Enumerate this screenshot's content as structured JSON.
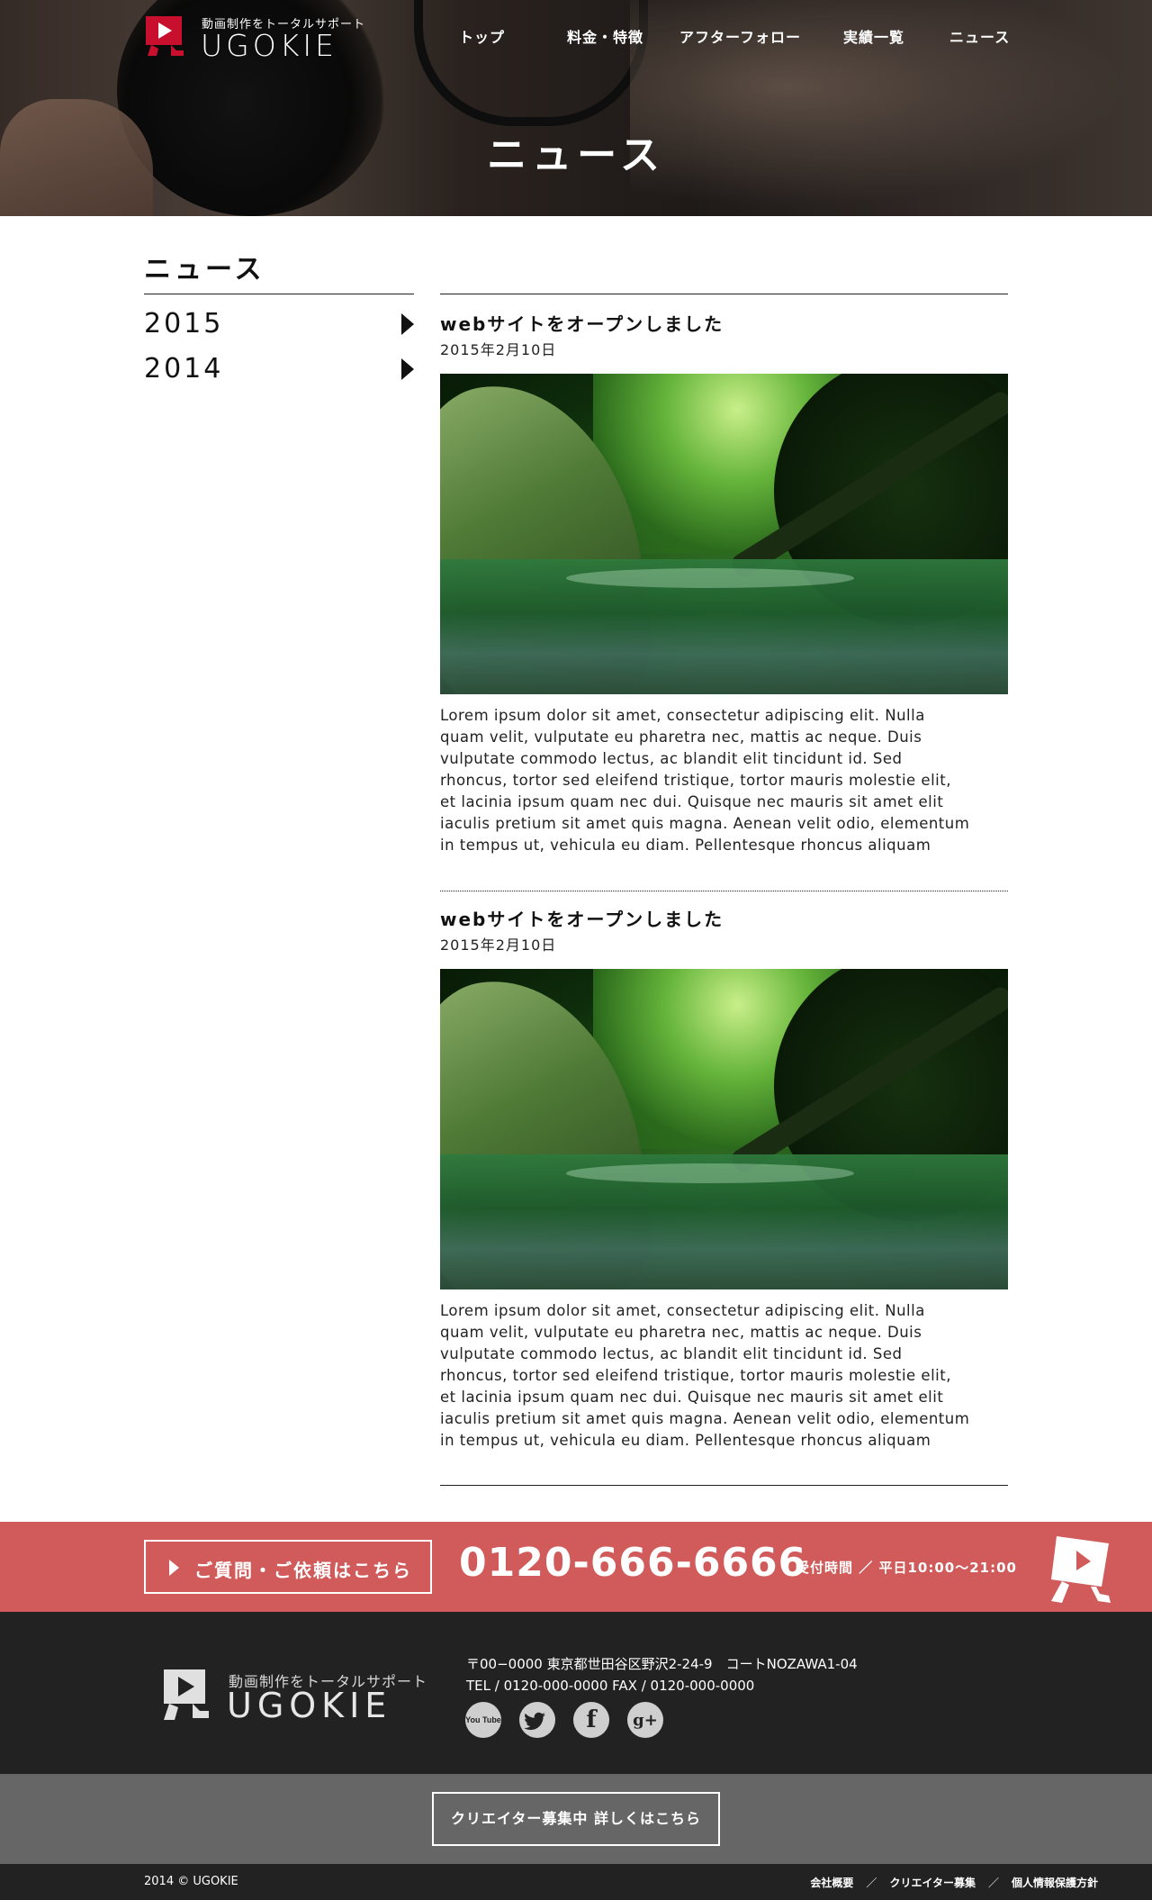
{
  "header": {
    "logo_tagline": "動画制作をトータルサポート",
    "logo_wordmark": "UGOKIE",
    "nav": [
      {
        "label": "トップ"
      },
      {
        "label": "料金・特徴"
      },
      {
        "label": "アフターフォロー"
      },
      {
        "label": "実績一覧"
      },
      {
        "label": "ニュース"
      }
    ],
    "hero_title": "ニュース"
  },
  "sidebar": {
    "title": "ニュース",
    "years": [
      {
        "label": "2015"
      },
      {
        "label": "2014"
      }
    ]
  },
  "posts": [
    {
      "title": "webサイトをオープンしました",
      "date": "2015年2月10日",
      "body_lines": [
        "Lorem ipsum dolor sit amet, consectetur adipiscing elit. Nulla",
        "quam velit, vulputate eu pharetra nec, mattis ac neque. Duis",
        "vulputate commodo lectus, ac blandit elit tincidunt id. Sed",
        "rhoncus, tortor sed eleifend tristique, tortor mauris molestie elit,",
        "et lacinia ipsum quam nec dui. Quisque nec mauris sit amet elit",
        "iaculis pretium sit amet quis magna. Aenean velit odio, elementum",
        "in tempus ut, vehicula eu diam. Pellentesque rhoncus aliquam"
      ]
    },
    {
      "title": "webサイトをオープンしました",
      "date": "2015年2月10日",
      "body_lines": [
        "Lorem ipsum dolor sit amet, consectetur adipiscing elit. Nulla",
        "quam velit, vulputate eu pharetra nec, mattis ac neque. Duis",
        "vulputate commodo lectus, ac blandit elit tincidunt id. Sed",
        "rhoncus, tortor sed eleifend tristique, tortor mauris molestie elit,",
        "et lacinia ipsum quam nec dui. Quisque nec mauris sit amet elit",
        "iaculis pretium sit amet quis magna. Aenean velit odio, elementum",
        "in tempus ut, vehicula eu diam. Pellentesque rhoncus aliquam"
      ]
    }
  ],
  "contact": {
    "button_label": "ご質問・ご依頼はこちら",
    "phone": "0120-666-6666",
    "hours": "受付時間 ／ 平日10:00～21:00"
  },
  "footer": {
    "logo_tagline": "動画制作をトータルサポート",
    "logo_wordmark": "UGOKIE",
    "address": "〒00−0000 東京都世田谷区野沢2-24-9　コートNOZAWA1-04",
    "tel_fax": "TEL / 0120-000-0000  FAX / 0120-000-0000",
    "social": [
      {
        "icon": "youtube-icon",
        "glyph": "You Tube"
      },
      {
        "icon": "twitter-icon",
        "glyph": "🐦"
      },
      {
        "icon": "facebook-icon",
        "glyph": "f"
      },
      {
        "icon": "google-plus-icon",
        "glyph": "g+"
      }
    ],
    "recruit_button": "クリエイター募集中 詳しくはこちら",
    "copyright": "2014 © UGOKIE",
    "links": [
      {
        "label": "会社概要"
      },
      {
        "label": "クリエイター募集"
      },
      {
        "label": "個人情報保護方針"
      }
    ]
  },
  "colors": {
    "accent_red": "#d15b5b",
    "logo_red": "#c8102e",
    "footer_dark": "#222222",
    "recruit_gray": "#666666"
  }
}
